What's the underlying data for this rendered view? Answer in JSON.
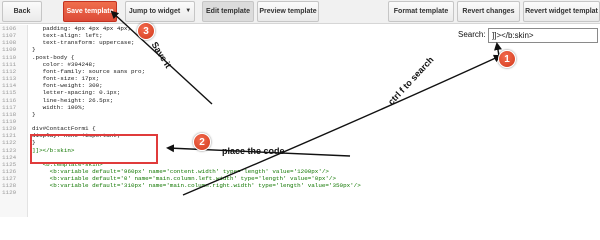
{
  "toolbar": {
    "back": "Back",
    "save_template": "Save template",
    "jump_to_widget": "Jump to widget",
    "edit_template": "Edit template",
    "preview_template": "Preview template",
    "format_template": "Format template",
    "revert_changes": "Revert changes",
    "revert_widget_templates": "Revert widget templat"
  },
  "search": {
    "label": "Search:",
    "value": "]]></b:skin>"
  },
  "code_lines": [
    {
      "n": "1106",
      "text": "   padding: 4px 4px 4px 4px;"
    },
    {
      "n": "1107",
      "text": "   text-align: left;"
    },
    {
      "n": "1108",
      "text": "   text-transform: uppercase;"
    },
    {
      "n": "1109",
      "text": "}"
    },
    {
      "n": "1110",
      "text": ".post-body {"
    },
    {
      "n": "1111",
      "text": "   color: #394248;"
    },
    {
      "n": "1112",
      "text": "   font-family: source sans pro;"
    },
    {
      "n": "1113",
      "text": "   font-size: 17px;"
    },
    {
      "n": "1114",
      "text": "   font-weight: 300;"
    },
    {
      "n": "1115",
      "text": "   letter-spacing: 0.1px;"
    },
    {
      "n": "1116",
      "text": "   line-height: 26.5px;"
    },
    {
      "n": "1117",
      "text": "   width: 100%;"
    },
    {
      "n": "1118",
      "text": "}"
    },
    {
      "n": "1119",
      "text": ""
    },
    {
      "n": "1120",
      "text": "div#ContactForm1 {"
    },
    {
      "n": "1121",
      "text": "display: none !important;"
    },
    {
      "n": "1122",
      "text": "}"
    },
    {
      "n": "1123",
      "text": "]]></b:skin>"
    },
    {
      "n": "1124",
      "text": ""
    },
    {
      "n": "1125",
      "text": "   <b:template-skin>"
    },
    {
      "n": "1126",
      "text": "     <b:variable default='960px' name='content.width' type='length' value='1200px'/>"
    },
    {
      "n": "1127",
      "text": "     <b:variable default='0' name='main.column.left.width' type='length' value='0px'/>"
    },
    {
      "n": "1128",
      "text": "     <b:variable default='310px' name='main.column.right.width' type='length' value='350px'/>"
    },
    {
      "n": "1129",
      "text": ""
    }
  ],
  "annotations": {
    "step1": "1",
    "step2": "2",
    "step3": "3",
    "ctrl_f": "ctrl f to search",
    "place_code": "place the code",
    "save_it": "Save it"
  },
  "colors": {
    "accent": "#dd4b39",
    "highlight_box": "#e03b3b"
  }
}
